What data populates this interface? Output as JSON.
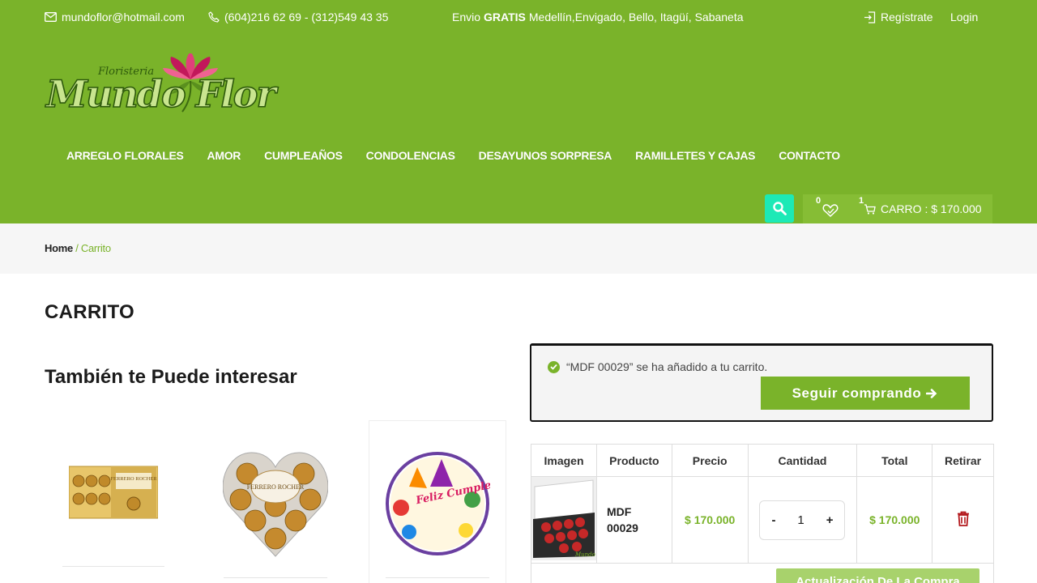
{
  "topbar": {
    "email": "mundoflor@hotmail.com",
    "phone": "(604)216 62 69 - (312)549 43 35",
    "shipping_prefix": "Envio",
    "shipping_bold": "GRATIS",
    "shipping_suffix": "Medellín,Envigado, Bello, Itagüí, Sabaneta",
    "register": "Regístrate",
    "login": "Login"
  },
  "logo": {
    "small": "Floristeria",
    "big": "Mundo Flor"
  },
  "nav": [
    "ARREGLO FLORALES",
    "AMOR",
    "CUMPLEAÑOS",
    "CONDOLENCIAS",
    "DESAYUNOS SORPRESA",
    "RAMILLETES Y CAJAS",
    "CONTACTO"
  ],
  "header_tools": {
    "wishlist_count": "0",
    "cart_count": "1",
    "cart_label": "CARRO : $ 170.000"
  },
  "breadcrumb": {
    "home": "Home",
    "separator": " / ",
    "current": "Carrito"
  },
  "page_title": "CARRITO",
  "related_title": "También te Puede interesar",
  "notice": {
    "message": "“MDF 00029” se ha añadido a tu carrito.",
    "button": "Seguir comprando"
  },
  "table": {
    "headers": [
      "Imagen",
      "Producto",
      "Precio",
      "Cantidad",
      "Total",
      "Retirar"
    ],
    "row": {
      "product_line1": "MDF",
      "product_line2": "00029",
      "price": "$ 170.000",
      "qty_minus": "-",
      "qty": "1",
      "qty_plus": "+",
      "total": "$ 170.000"
    },
    "update_button": "Actualización De La Compra"
  },
  "related_products": [
    {
      "label": "FERRERO ROCHER",
      "icon": "ferrero-box-image"
    },
    {
      "label": "FERRERO ROCHER",
      "icon": "ferrero-heart-image"
    },
    {
      "label": "Feliz Cumpleaños",
      "icon": "birthday-balloon-image"
    }
  ],
  "colors": {
    "brand_green": "#7ab32a",
    "search_teal": "#1de9b6",
    "trash_red": "#b3171b"
  }
}
